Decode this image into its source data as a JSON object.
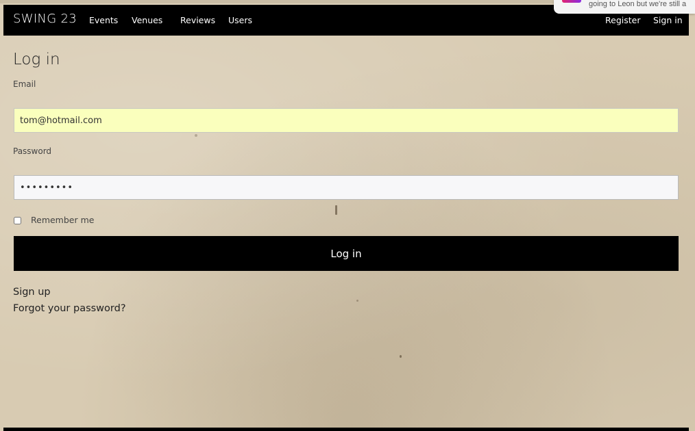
{
  "navbar": {
    "brand": "SWING 23",
    "links": [
      "Events",
      "Venues",
      "Reviews",
      "Users"
    ],
    "register": "Register",
    "sign_in": "Sign in"
  },
  "notification": {
    "text": "going to Leon but we're still a"
  },
  "page": {
    "title": "Log in"
  },
  "form": {
    "email_label": "Email",
    "email_value": "tom@hotmail.com",
    "password_label": "Password",
    "password_value": "•••••••••",
    "remember_label": "Remember me",
    "remember_checked": false,
    "submit_label": "Log in"
  },
  "links": {
    "sign_up": "Sign up",
    "forgot_password": "Forgot your password?"
  },
  "colors": {
    "navbar_bg": "#000000",
    "page_bg": "#d8cbb2",
    "email_autofill_bg": "#faffbd",
    "button_bg": "#000000"
  }
}
